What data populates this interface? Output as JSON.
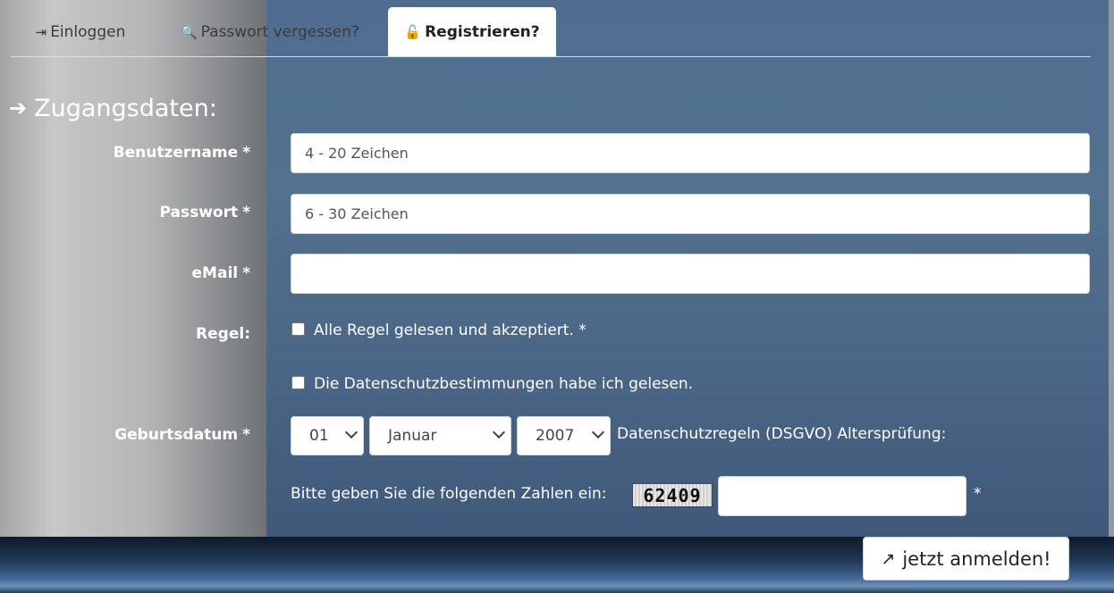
{
  "tabs": [
    {
      "icon": "sign-in-icon",
      "glyph": "⇥",
      "label": "Einloggen"
    },
    {
      "icon": "key-icon",
      "glyph": "🔍",
      "label": "Passwort vergessen?"
    },
    {
      "icon": "lock-icon",
      "glyph": "🔓",
      "label": "Registrieren?"
    }
  ],
  "section": {
    "icon": "sign-in-icon",
    "glyph": "➔",
    "title": "Zugangsdaten:"
  },
  "form": {
    "username": {
      "label": "Benutzername",
      "required": "*",
      "placeholder": "4 - 20 Zeichen"
    },
    "password": {
      "label": "Passwort",
      "required": "*",
      "placeholder": "6 - 30 Zeichen"
    },
    "email": {
      "label": "eMail",
      "required": "*",
      "placeholder": ""
    },
    "rules": {
      "label": "Regel:",
      "accept_text": "Alle Regel gelesen und akzeptiert. *",
      "privacy_text": "Die Datenschutzbestimmungen habe ich gelesen."
    },
    "birthdate": {
      "label": "Geburtsdatum",
      "required": "*",
      "day": "01",
      "month": "Januar",
      "year": "2007",
      "note": "Datenschutzregeln (DSGVO) Altersprüfung:"
    },
    "captcha": {
      "prompt": "Bitte geben Sie die folgenden Zahlen ein:",
      "code": "62409",
      "required": "*"
    }
  },
  "submit": {
    "icon": "share-icon",
    "glyph": "↗",
    "label": "jetzt anmelden!"
  },
  "colors": {
    "panel_blue": "#4f6d8f",
    "side_gray": "#c6c8c6",
    "footer_dark": "#1f3552"
  }
}
